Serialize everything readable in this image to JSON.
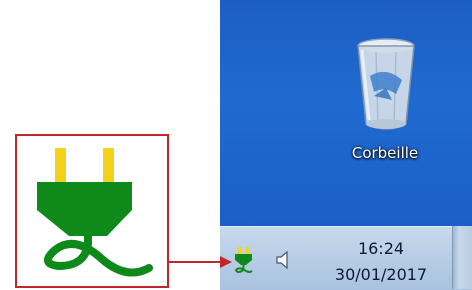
{
  "desktop": {
    "recycle_bin": {
      "label": "Corbeille",
      "icon": "recycle-bin-icon"
    }
  },
  "taskbar": {
    "tray": {
      "power_icon": "power-plug-icon",
      "volume_icon": "speaker-icon"
    },
    "clock": {
      "time": "16:24",
      "date": "30/01/2017"
    }
  },
  "callout": {
    "icon": "power-plug-icon",
    "colors": {
      "plug_body": "#0f8a1a",
      "prongs": "#f2d21b",
      "border": "#c0282d"
    }
  },
  "colors": {
    "desktop_blue": "#1f64cc",
    "taskbar": "#b7cde6",
    "arrow": "#c0282d"
  }
}
